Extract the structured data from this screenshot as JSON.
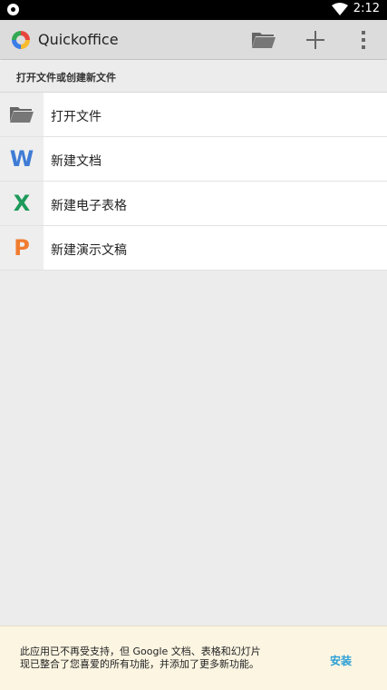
{
  "status_bar": {
    "time": "2:12"
  },
  "app_bar": {
    "title": "Quickoffice"
  },
  "section": {
    "title": "打开文件或创建新文件"
  },
  "list": {
    "items": [
      {
        "icon": "folder-icon",
        "label": "打开文件"
      },
      {
        "icon": "word-doc-icon",
        "glyph": "W",
        "label": "新建文档"
      },
      {
        "icon": "spreadsheet-icon",
        "glyph": "X",
        "label": "新建电子表格"
      },
      {
        "icon": "presentation-icon",
        "glyph": "P",
        "label": "新建演示文稿"
      }
    ]
  },
  "banner": {
    "line1": "此应用已不再受支持，但 Google 文档、表格和幻灯片",
    "line2": "现已整合了您喜爱的所有功能，并添加了更多新功能。",
    "install_label": "安装"
  },
  "colors": {
    "word": "#3f7cd6",
    "sheets": "#1e9a5b",
    "slides": "#f07c2f",
    "install": "#2a9fd6"
  }
}
